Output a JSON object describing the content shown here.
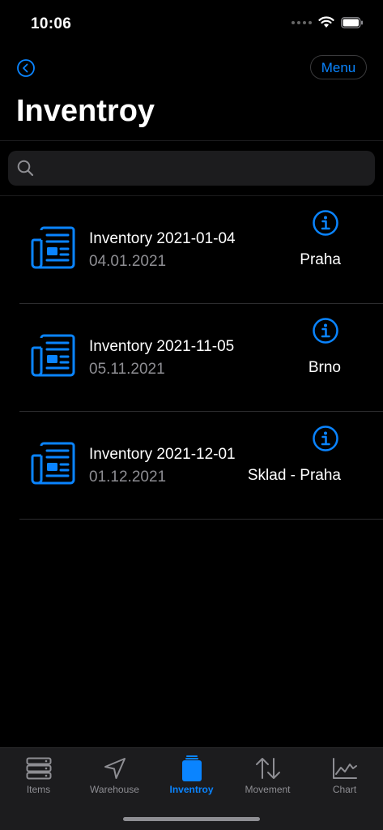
{
  "status_bar": {
    "time": "10:06"
  },
  "nav": {
    "menu_label": "Menu"
  },
  "page": {
    "title": "Inventroy"
  },
  "search": {
    "placeholder": ""
  },
  "inventories": [
    {
      "title": "Inventory 2021-01-04",
      "date": "04.01.2021",
      "location": "Praha"
    },
    {
      "title": "Inventory 2021-11-05",
      "date": "05.11.2021",
      "location": "Brno"
    },
    {
      "title": "Inventory 2021-12-01",
      "date": "01.12.2021",
      "location": "Sklad - Praha"
    }
  ],
  "tab_bar": {
    "items": [
      {
        "label": "Items",
        "icon": "server-icon"
      },
      {
        "label": "Warehouse",
        "icon": "location-arrow-icon"
      },
      {
        "label": "Inventroy",
        "icon": "jar-icon",
        "active": true
      },
      {
        "label": "Movement",
        "icon": "up-down-arrows-icon"
      },
      {
        "label": "Chart",
        "icon": "line-chart-icon"
      }
    ]
  },
  "colors": {
    "accent": "#0a84ff",
    "background": "#000000",
    "secondary_text": "#8e8e93"
  }
}
